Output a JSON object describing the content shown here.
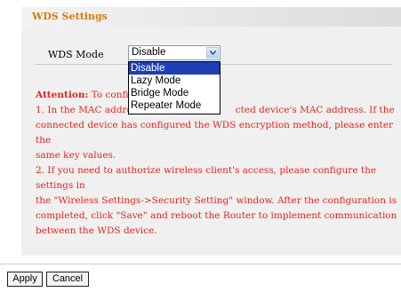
{
  "header": {
    "title": "WDS Settings"
  },
  "wds": {
    "mode_label": "WDS Mode",
    "mode_value": "Disable",
    "options": [
      "Disable",
      "Lazy Mode",
      "Bridge Mode",
      "Repeater Mode"
    ],
    "selected_option": "Disable"
  },
  "attention": {
    "label": "Attention:",
    "line1_start": "To confi",
    "line2_start": "1. In the MAC addre",
    "line2_end": "cted device's MAC address. If the",
    "line3": "connected device has configured the WDS encryption method, please enter the",
    "line4": "same key values.",
    "line5": "2. If you need to authorize wireless client's access, please configure the settings in",
    "line6": "the \"Wireless Settings->Security Setting\" window. After the configuration is",
    "line7": "completed, click \"Save\" and reboot the Router to implement communication",
    "line8": "between the WDS device."
  },
  "buttons": {
    "apply": "Apply",
    "cancel": "Cancel"
  },
  "colors": {
    "title": "#d87a14",
    "attention": "#e0261e",
    "selected_option_bg": "#1e3fb4"
  }
}
